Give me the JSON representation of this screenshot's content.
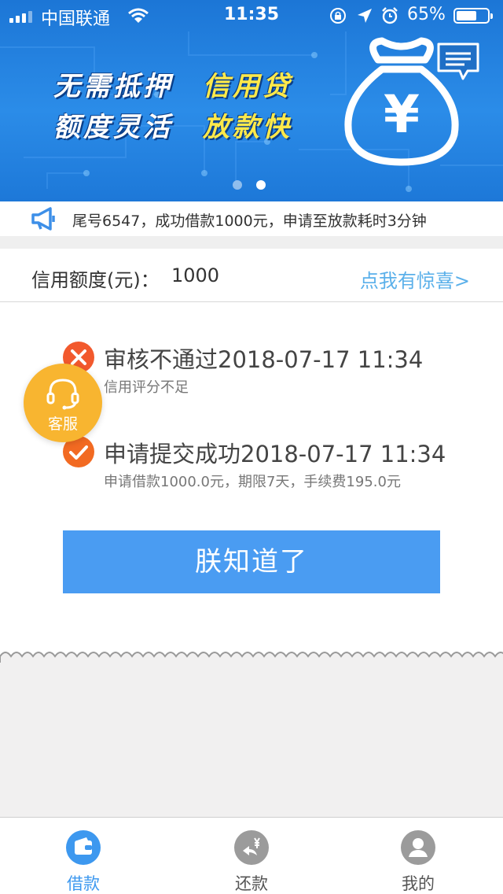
{
  "status_bar": {
    "carrier": "中国联通",
    "time": "11:35",
    "battery_percent": "65%",
    "battery_level": 0.65
  },
  "banner": {
    "slogan_line1_left": "无需抵押",
    "slogan_line1_right": "信用贷",
    "slogan_line2_left": "额度灵活",
    "slogan_line2_right": "放款快",
    "currency_symbol": "¥",
    "slides_count": 2,
    "active_slide": 2,
    "icons": [
      "money-bag-icon",
      "chat-icon"
    ],
    "colors": {
      "background": "#1c76d6",
      "highlight_text": "#ffe94a"
    }
  },
  "notice": {
    "text": "尾号6547，成功借款1000元，申请至放款耗时3分钟",
    "icon": "megaphone-icon"
  },
  "credit": {
    "label": "信用额度(元)：",
    "value": "1000",
    "link": "点我有惊喜>"
  },
  "timeline": [
    {
      "status": "rejected",
      "title": "审核不通过2018-07-17 11:34",
      "desc": "信用评分不足",
      "icon": "close-icon",
      "color": "#f2592d"
    },
    {
      "status": "submitted",
      "title": "申请提交成功2018-07-17 11:34",
      "desc": "申请借款1000.0元，期限7天，手续费195.0元",
      "icon": "check-icon",
      "color": "#f26a22"
    }
  ],
  "service": {
    "label": "客服",
    "icon": "headset-icon",
    "color": "#f8b530"
  },
  "confirm_button": {
    "label": "朕知道了",
    "color": "#4a9cf2"
  },
  "tabbar": {
    "tabs": [
      {
        "label": "借款",
        "icon": "wallet-icon",
        "active": true
      },
      {
        "label": "还款",
        "icon": "repay-icon",
        "active": false
      },
      {
        "label": "我的",
        "icon": "user-icon",
        "active": false
      }
    ],
    "active_color": "#3d98ef"
  }
}
